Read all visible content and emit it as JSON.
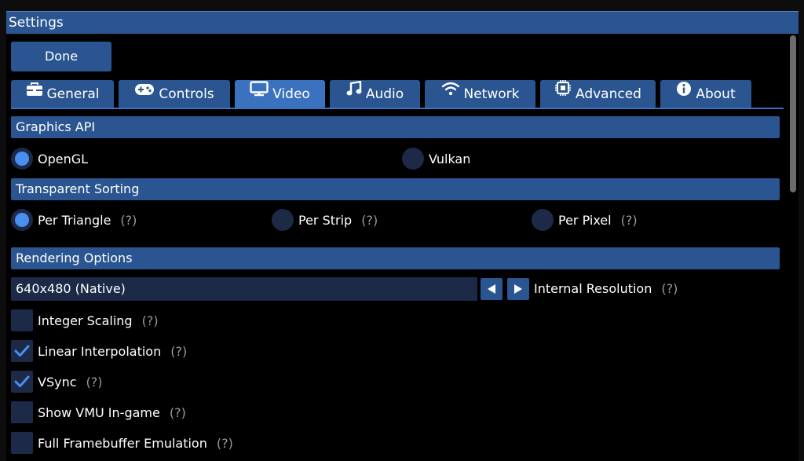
{
  "window": {
    "title": "Settings"
  },
  "toolbar": {
    "done_label": "Done"
  },
  "tabs": [
    {
      "label": "General",
      "icon": "toolbox-icon"
    },
    {
      "label": "Controls",
      "icon": "gamepad-icon"
    },
    {
      "label": "Video",
      "icon": "monitor-icon",
      "active": true
    },
    {
      "label": "Audio",
      "icon": "music-note-icon"
    },
    {
      "label": "Network",
      "icon": "wifi-icon"
    },
    {
      "label": "Advanced",
      "icon": "chip-icon"
    },
    {
      "label": "About",
      "icon": "info-icon"
    }
  ],
  "help_marker": "(?)",
  "graphics_api": {
    "title": "Graphics API",
    "options": [
      {
        "label": "OpenGL",
        "selected": true
      },
      {
        "label": "Vulkan",
        "selected": false
      }
    ]
  },
  "transparent_sorting": {
    "title": "Transparent Sorting",
    "options": [
      {
        "label": "Per Triangle",
        "selected": true
      },
      {
        "label": "Per Strip",
        "selected": false
      },
      {
        "label": "Per Pixel",
        "selected": false
      }
    ]
  },
  "rendering_options": {
    "title": "Rendering Options",
    "resolution_value": "640x480 (Native)",
    "resolution_label": "Internal Resolution",
    "checkboxes": [
      {
        "label": "Integer Scaling",
        "checked": false
      },
      {
        "label": "Linear Interpolation",
        "checked": true
      },
      {
        "label": "VSync",
        "checked": true
      },
      {
        "label": "Show VMU In-game",
        "checked": false
      },
      {
        "label": "Full Framebuffer Emulation",
        "checked": false
      }
    ]
  },
  "colors": {
    "accent": "#2a5590",
    "active_tab": "#3a72c0",
    "control_bg": "#1c2a48",
    "selected_dot": "#4a8ff0",
    "help_text": "#9a9a9a"
  }
}
